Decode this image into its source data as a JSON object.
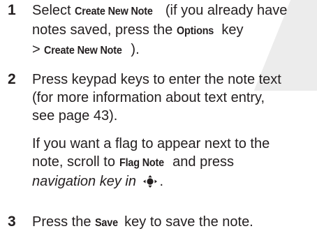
{
  "steps": [
    {
      "number": "1",
      "t1": "Select ",
      "b1": "Create New Note",
      "t2": " (if you already have",
      "t3": "notes saved, press the ",
      "b2": "Options",
      "t4": " key",
      "t5": "> ",
      "b3": "Create New Note",
      "t6": ")."
    },
    {
      "number": "2",
      "line1": "Press keypad keys to enter the note text",
      "line2": "(for more information about text entry,",
      "line3": "see page 43).",
      "p2_line1": "If you want a flag to appear next to the",
      "p2_t1": "note, scroll to ",
      "p2_b1": "Flag Note",
      "p2_t2": " and press",
      "p2_italic": "navigation key in",
      "p2_icon": "nav-center-key-icon",
      "p2_end": "."
    },
    {
      "number": "3",
      "t1": "Press the ",
      "b1": "Save",
      "t2": " key to save the note."
    }
  ]
}
